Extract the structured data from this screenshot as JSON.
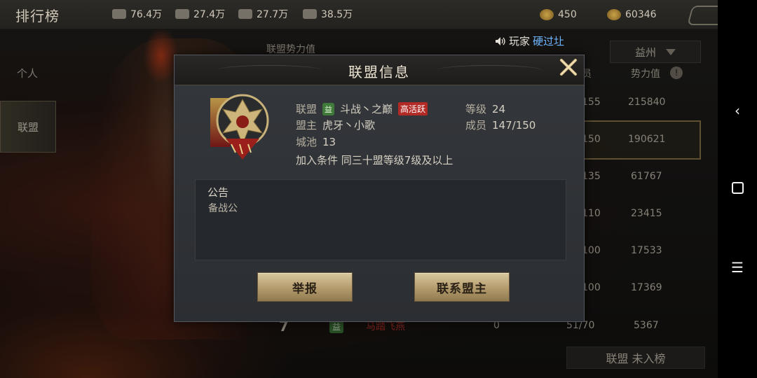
{
  "header": {
    "title": "排行榜",
    "resources": [
      {
        "icon": "wood-icon",
        "value": "76.4万"
      },
      {
        "icon": "iron-icon",
        "value": "27.4万"
      },
      {
        "icon": "stone-icon",
        "value": "27.7万"
      },
      {
        "icon": "grain-icon",
        "value": "38.5万"
      }
    ],
    "coins": [
      {
        "icon": "gold-coin-icon",
        "value": "450"
      },
      {
        "icon": "copper-coin-icon",
        "value": "60346"
      }
    ]
  },
  "tabs": [
    "个人",
    "联盟"
  ],
  "ranking": {
    "heading": "联盟势力值",
    "column_members": "员",
    "column_power": "势力值",
    "region": "益州",
    "rows": [
      {
        "members": "155",
        "power": "215840"
      },
      {
        "members": "150",
        "power": "190621"
      },
      {
        "members": "135",
        "power": "61767"
      },
      {
        "members": "110",
        "power": "23415"
      },
      {
        "members": "100",
        "power": "17533"
      },
      {
        "members": "100",
        "power": "17369"
      }
    ],
    "row7": {
      "rank": "7",
      "tag": "益",
      "name": "马踏飞燕",
      "score": "0",
      "members": "51/70",
      "power": "5367"
    },
    "self_rank": "联盟  未入榜"
  },
  "banner": {
    "prefix": "玩家",
    "highlight": "硬过圵"
  },
  "dialog": {
    "title": "联盟信息",
    "alliance_label": "联盟",
    "alliance_tag": "益",
    "alliance_name": "斗战丶之巅",
    "activity": "高活跃",
    "level_label": "等级",
    "level": "24",
    "leader_label": "盟主",
    "leader": "虎牙丶小歌",
    "members_label": "成员",
    "members": "147/150",
    "cities_label": "城池",
    "cities": "13",
    "condition": "加入条件  同三十盟等级7级及以上",
    "notice_title": "公告",
    "notice_body": "备战公",
    "report_button": "举报",
    "contact_button": "联系盟主"
  },
  "colors": {
    "accent_gold": "#b49b6c",
    "active_red": "#b22a26",
    "tag_green": "#3f7a3a",
    "banner_blue": "#6fb7ff"
  }
}
